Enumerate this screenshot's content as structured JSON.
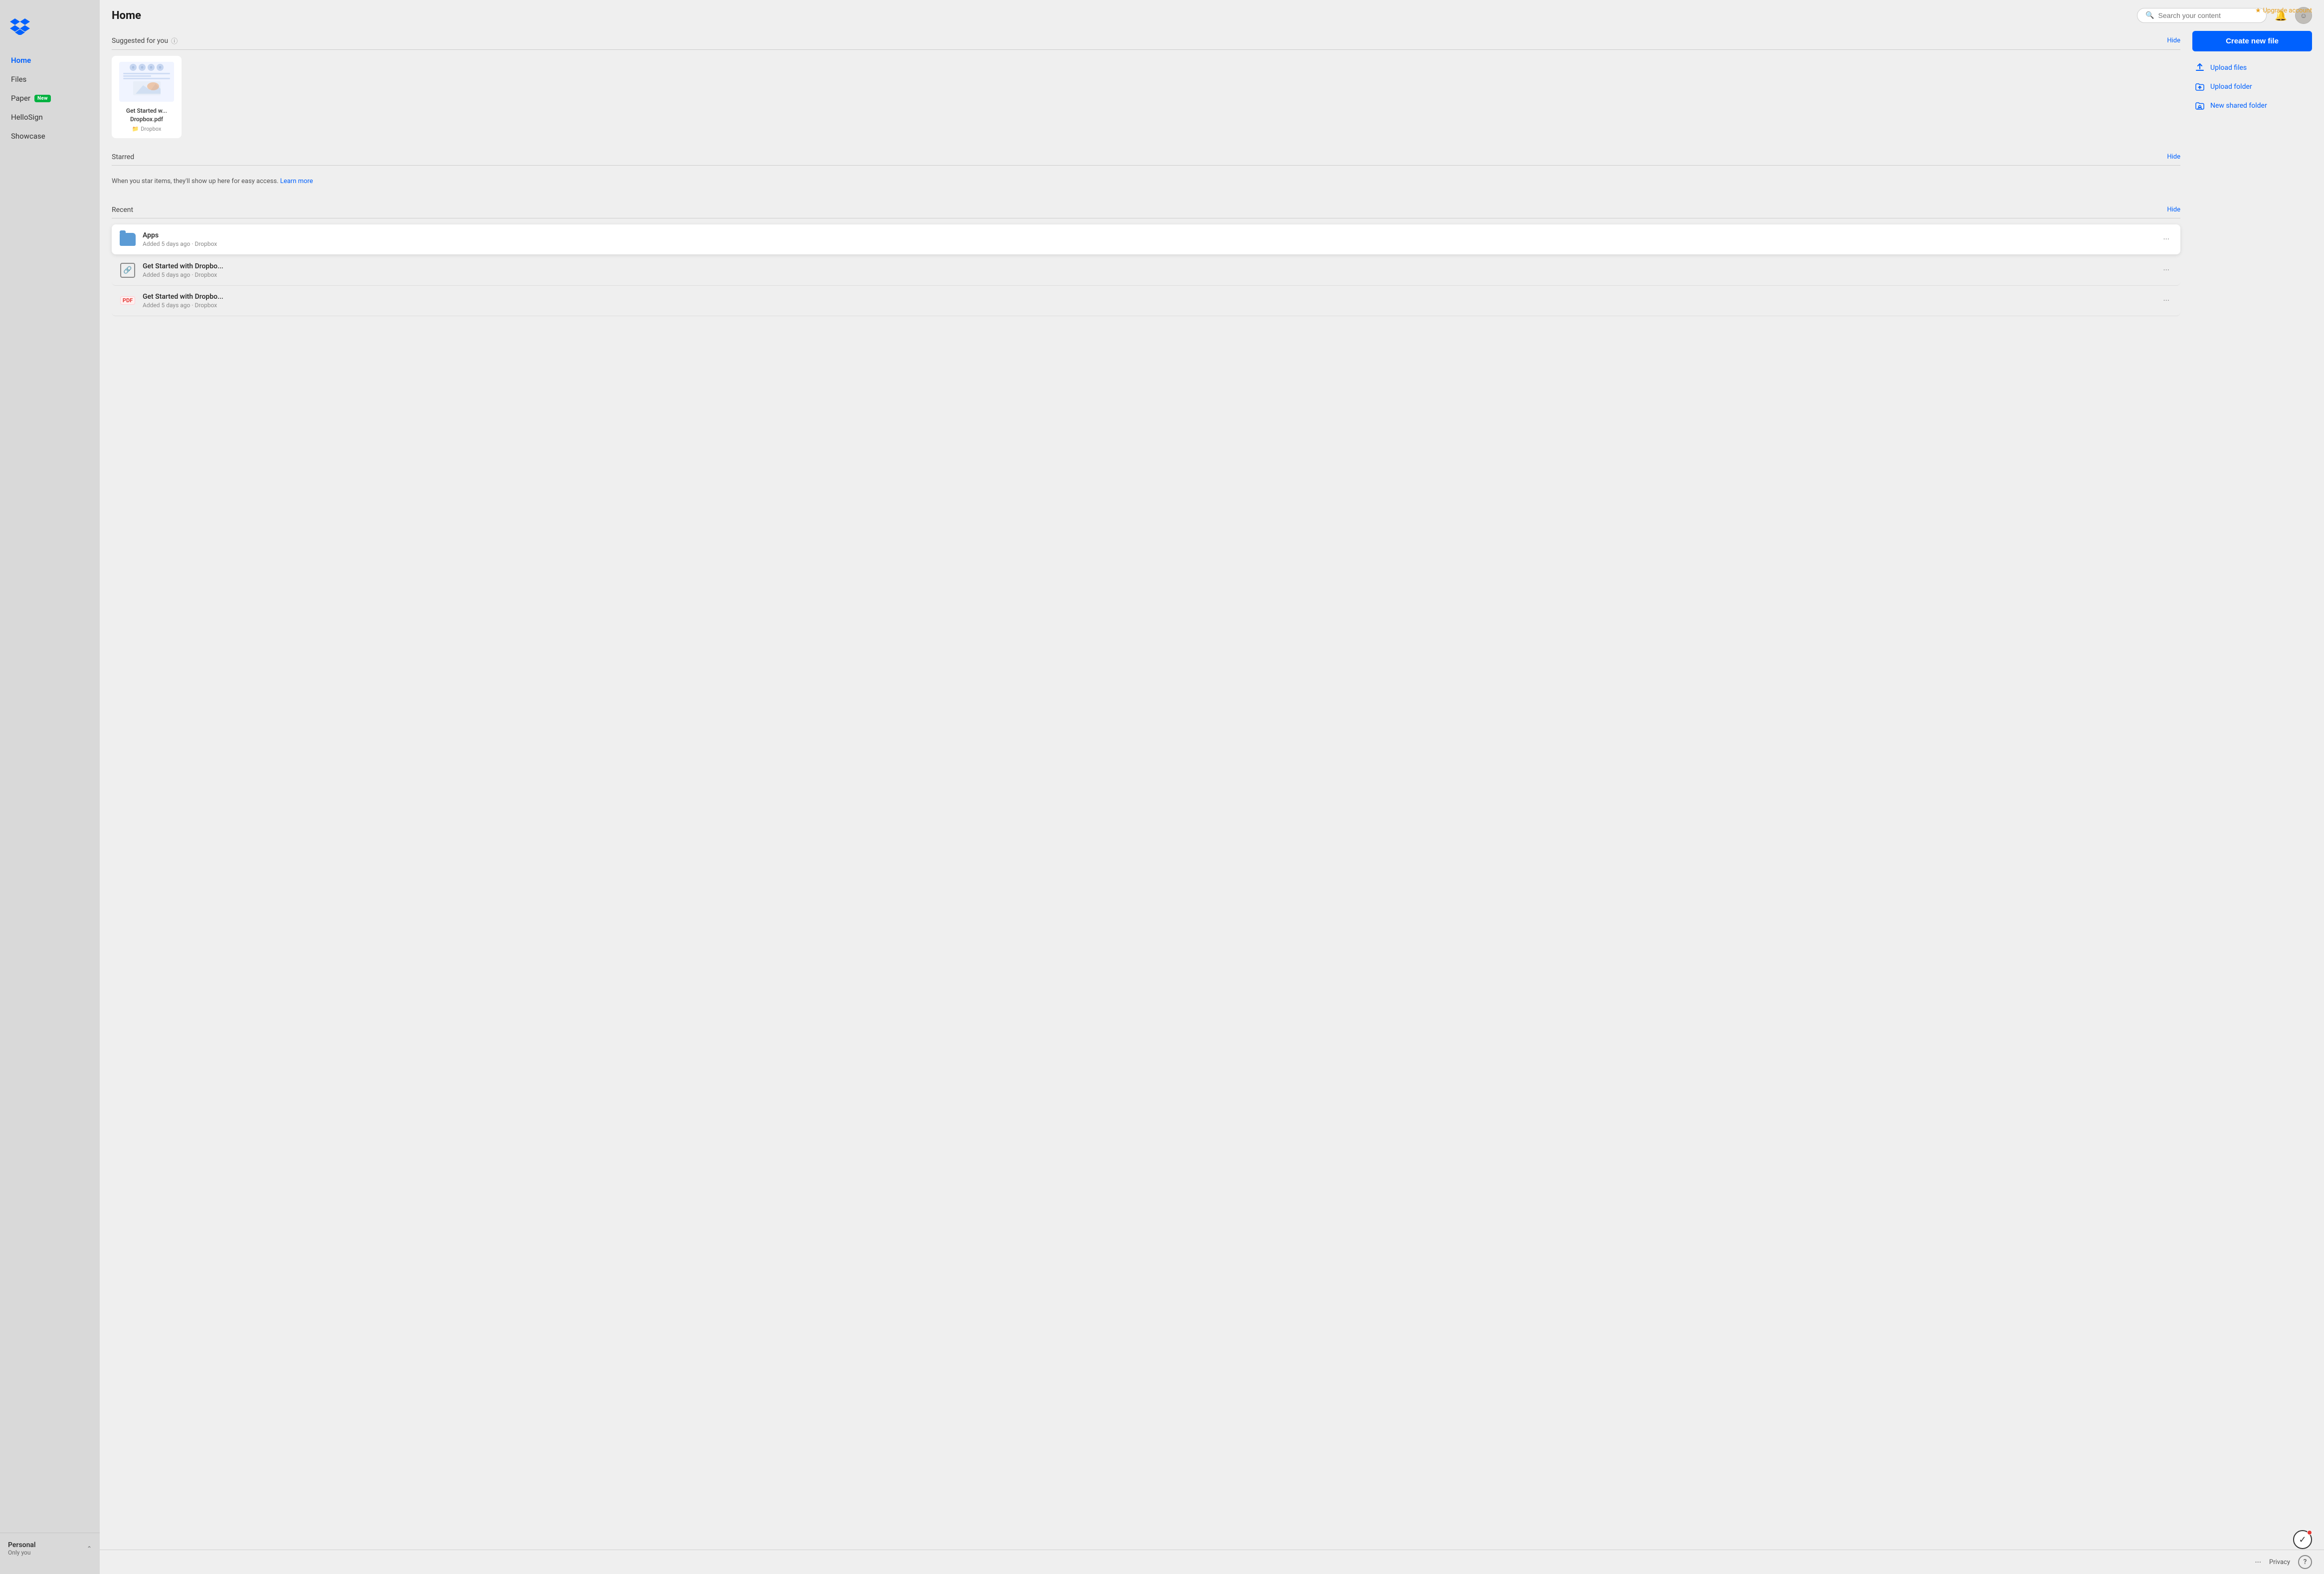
{
  "upgrade": {
    "label": "Upgrade account",
    "icon": "star-icon"
  },
  "sidebar": {
    "items": [
      {
        "id": "home",
        "label": "Home",
        "active": true
      },
      {
        "id": "files",
        "label": "Files",
        "active": false
      },
      {
        "id": "paper",
        "label": "Paper",
        "active": false,
        "badge": "New"
      },
      {
        "id": "hellosign",
        "label": "HelloSign",
        "active": false
      },
      {
        "id": "showcase",
        "label": "Showcase",
        "active": false
      }
    ],
    "footer": {
      "account_name": "Personal",
      "account_sub": "Only you"
    }
  },
  "header": {
    "title": "Home",
    "search_placeholder": "Search your content"
  },
  "suggested": {
    "title": "Suggested for you",
    "hide_label": "Hide",
    "file": {
      "name": "Get Started w... Dropbox.pdf",
      "location": "Dropbox"
    }
  },
  "starred": {
    "title": "Starred",
    "hide_label": "Hide",
    "empty_text": "When you star items, they'll show up here for easy access.",
    "learn_more": "Learn more"
  },
  "recent": {
    "title": "Recent",
    "hide_label": "Hide",
    "items": [
      {
        "type": "folder",
        "name": "Apps",
        "meta": "Added 5 days ago · Dropbox",
        "highlighted": true
      },
      {
        "type": "link",
        "name": "Get Started with Dropbo...",
        "meta": "Added 5 days ago · Dropbox",
        "highlighted": false
      },
      {
        "type": "pdf",
        "name": "Get Started with Dropbo...",
        "meta": "Added 5 days ago · Dropbox",
        "highlighted": false
      }
    ]
  },
  "actions": {
    "create_new_file": "Create new file",
    "upload_files": "Upload files",
    "upload_folder": "Upload folder",
    "new_shared_folder": "New shared folder"
  },
  "footer": {
    "privacy": "Privacy",
    "help": "?"
  }
}
